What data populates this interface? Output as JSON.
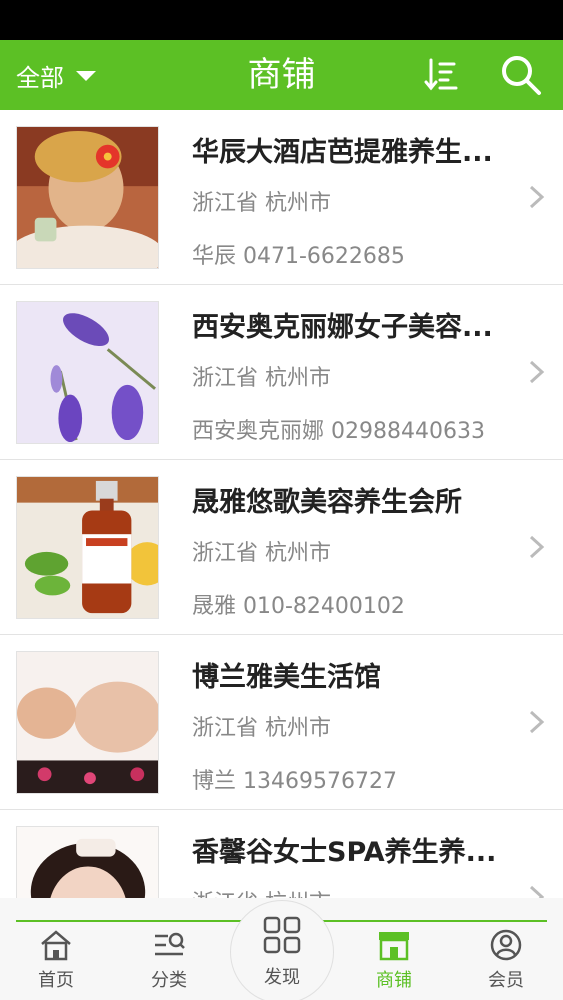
{
  "header": {
    "filter_label": "全部",
    "title": "商铺",
    "sort_icon": "sort-icon",
    "search_icon": "search-icon"
  },
  "shops": [
    {
      "name": "华辰大酒店芭提雅养生...",
      "location": "浙江省 杭州市",
      "contact": "华辰 0471-6622685",
      "image": "spa-woman-flower-image"
    },
    {
      "name": "西安奥克丽娜女子美容...",
      "location": "浙江省 杭州市",
      "contact": "西安奥克丽娜 02988440633",
      "image": "lavender-image"
    },
    {
      "name": "晟雅悠歌美容养生会所",
      "location": "浙江省 杭州市",
      "contact": "晟雅 010-82400102",
      "image": "essential-oil-bottle-image"
    },
    {
      "name": "博兰雅美生活馆",
      "location": "浙江省 杭州市",
      "contact": "博兰 13469576727",
      "image": "facial-massage-image"
    },
    {
      "name": "香馨谷女士SPA养生养...",
      "location": "浙江省 杭州市",
      "contact": "",
      "image": "spa-face-image"
    }
  ],
  "tabbar": {
    "home": "首页",
    "category": "分类",
    "discover": "发现",
    "shop": "商铺",
    "member": "会员",
    "active": "shop"
  },
  "colors": {
    "brand_green": "#5cc025",
    "status_bar": "#000000",
    "text_primary": "#222222",
    "text_secondary": "#888888"
  }
}
